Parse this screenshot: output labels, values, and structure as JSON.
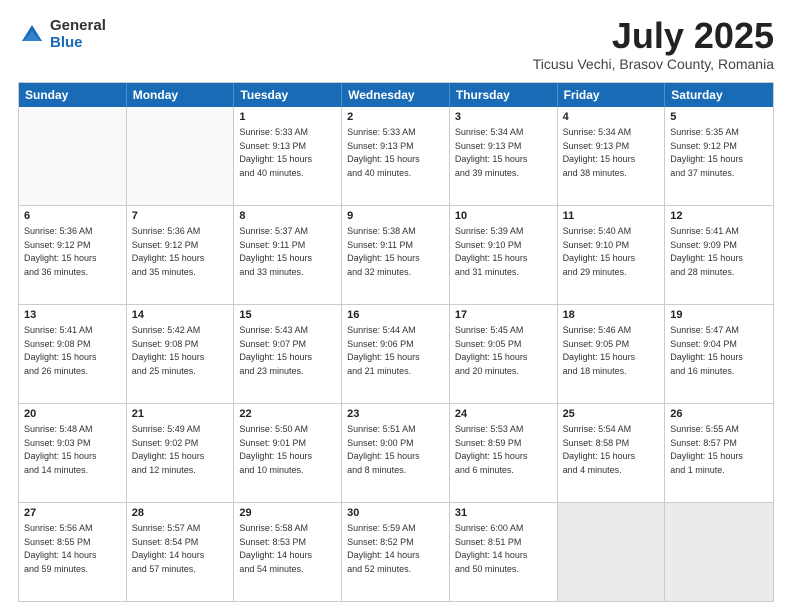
{
  "logo": {
    "general": "General",
    "blue": "Blue"
  },
  "title": {
    "month": "July 2025",
    "location": "Ticusu Vechi, Brasov County, Romania"
  },
  "header_days": [
    "Sunday",
    "Monday",
    "Tuesday",
    "Wednesday",
    "Thursday",
    "Friday",
    "Saturday"
  ],
  "rows": [
    [
      {
        "day": "",
        "info": "",
        "empty": true
      },
      {
        "day": "",
        "info": "",
        "empty": true
      },
      {
        "day": "1",
        "info": "Sunrise: 5:33 AM\nSunset: 9:13 PM\nDaylight: 15 hours\nand 40 minutes.",
        "empty": false
      },
      {
        "day": "2",
        "info": "Sunrise: 5:33 AM\nSunset: 9:13 PM\nDaylight: 15 hours\nand 40 minutes.",
        "empty": false
      },
      {
        "day": "3",
        "info": "Sunrise: 5:34 AM\nSunset: 9:13 PM\nDaylight: 15 hours\nand 39 minutes.",
        "empty": false
      },
      {
        "day": "4",
        "info": "Sunrise: 5:34 AM\nSunset: 9:13 PM\nDaylight: 15 hours\nand 38 minutes.",
        "empty": false
      },
      {
        "day": "5",
        "info": "Sunrise: 5:35 AM\nSunset: 9:12 PM\nDaylight: 15 hours\nand 37 minutes.",
        "empty": false
      }
    ],
    [
      {
        "day": "6",
        "info": "Sunrise: 5:36 AM\nSunset: 9:12 PM\nDaylight: 15 hours\nand 36 minutes.",
        "empty": false
      },
      {
        "day": "7",
        "info": "Sunrise: 5:36 AM\nSunset: 9:12 PM\nDaylight: 15 hours\nand 35 minutes.",
        "empty": false
      },
      {
        "day": "8",
        "info": "Sunrise: 5:37 AM\nSunset: 9:11 PM\nDaylight: 15 hours\nand 33 minutes.",
        "empty": false
      },
      {
        "day": "9",
        "info": "Sunrise: 5:38 AM\nSunset: 9:11 PM\nDaylight: 15 hours\nand 32 minutes.",
        "empty": false
      },
      {
        "day": "10",
        "info": "Sunrise: 5:39 AM\nSunset: 9:10 PM\nDaylight: 15 hours\nand 31 minutes.",
        "empty": false
      },
      {
        "day": "11",
        "info": "Sunrise: 5:40 AM\nSunset: 9:10 PM\nDaylight: 15 hours\nand 29 minutes.",
        "empty": false
      },
      {
        "day": "12",
        "info": "Sunrise: 5:41 AM\nSunset: 9:09 PM\nDaylight: 15 hours\nand 28 minutes.",
        "empty": false
      }
    ],
    [
      {
        "day": "13",
        "info": "Sunrise: 5:41 AM\nSunset: 9:08 PM\nDaylight: 15 hours\nand 26 minutes.",
        "empty": false
      },
      {
        "day": "14",
        "info": "Sunrise: 5:42 AM\nSunset: 9:08 PM\nDaylight: 15 hours\nand 25 minutes.",
        "empty": false
      },
      {
        "day": "15",
        "info": "Sunrise: 5:43 AM\nSunset: 9:07 PM\nDaylight: 15 hours\nand 23 minutes.",
        "empty": false
      },
      {
        "day": "16",
        "info": "Sunrise: 5:44 AM\nSunset: 9:06 PM\nDaylight: 15 hours\nand 21 minutes.",
        "empty": false
      },
      {
        "day": "17",
        "info": "Sunrise: 5:45 AM\nSunset: 9:05 PM\nDaylight: 15 hours\nand 20 minutes.",
        "empty": false
      },
      {
        "day": "18",
        "info": "Sunrise: 5:46 AM\nSunset: 9:05 PM\nDaylight: 15 hours\nand 18 minutes.",
        "empty": false
      },
      {
        "day": "19",
        "info": "Sunrise: 5:47 AM\nSunset: 9:04 PM\nDaylight: 15 hours\nand 16 minutes.",
        "empty": false
      }
    ],
    [
      {
        "day": "20",
        "info": "Sunrise: 5:48 AM\nSunset: 9:03 PM\nDaylight: 15 hours\nand 14 minutes.",
        "empty": false
      },
      {
        "day": "21",
        "info": "Sunrise: 5:49 AM\nSunset: 9:02 PM\nDaylight: 15 hours\nand 12 minutes.",
        "empty": false
      },
      {
        "day": "22",
        "info": "Sunrise: 5:50 AM\nSunset: 9:01 PM\nDaylight: 15 hours\nand 10 minutes.",
        "empty": false
      },
      {
        "day": "23",
        "info": "Sunrise: 5:51 AM\nSunset: 9:00 PM\nDaylight: 15 hours\nand 8 minutes.",
        "empty": false
      },
      {
        "day": "24",
        "info": "Sunrise: 5:53 AM\nSunset: 8:59 PM\nDaylight: 15 hours\nand 6 minutes.",
        "empty": false
      },
      {
        "day": "25",
        "info": "Sunrise: 5:54 AM\nSunset: 8:58 PM\nDaylight: 15 hours\nand 4 minutes.",
        "empty": false
      },
      {
        "day": "26",
        "info": "Sunrise: 5:55 AM\nSunset: 8:57 PM\nDaylight: 15 hours\nand 1 minute.",
        "empty": false
      }
    ],
    [
      {
        "day": "27",
        "info": "Sunrise: 5:56 AM\nSunset: 8:55 PM\nDaylight: 14 hours\nand 59 minutes.",
        "empty": false
      },
      {
        "day": "28",
        "info": "Sunrise: 5:57 AM\nSunset: 8:54 PM\nDaylight: 14 hours\nand 57 minutes.",
        "empty": false
      },
      {
        "day": "29",
        "info": "Sunrise: 5:58 AM\nSunset: 8:53 PM\nDaylight: 14 hours\nand 54 minutes.",
        "empty": false
      },
      {
        "day": "30",
        "info": "Sunrise: 5:59 AM\nSunset: 8:52 PM\nDaylight: 14 hours\nand 52 minutes.",
        "empty": false
      },
      {
        "day": "31",
        "info": "Sunrise: 6:00 AM\nSunset: 8:51 PM\nDaylight: 14 hours\nand 50 minutes.",
        "empty": false
      },
      {
        "day": "",
        "info": "",
        "empty": true
      },
      {
        "day": "",
        "info": "",
        "empty": true
      }
    ]
  ]
}
